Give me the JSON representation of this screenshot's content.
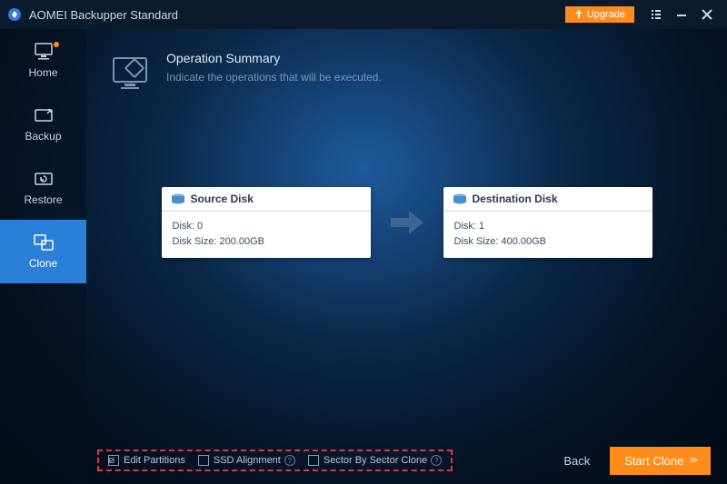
{
  "app": {
    "title": "AOMEI Backupper Standard",
    "upgrade_label": "Upgrade"
  },
  "sidebar": {
    "items": [
      {
        "label": "Home"
      },
      {
        "label": "Backup"
      },
      {
        "label": "Restore"
      },
      {
        "label": "Clone"
      }
    ]
  },
  "summary": {
    "title": "Operation Summary",
    "subtitle": "Indicate the operations that will be executed."
  },
  "source": {
    "title": "Source Disk",
    "line1": "Disk: 0",
    "line2": "Disk Size: 200.00GB"
  },
  "destination": {
    "title": "Destination Disk",
    "line1": "Disk: 1",
    "line2": "Disk Size: 400.00GB"
  },
  "options": {
    "edit_partitions": "Edit Partitions",
    "ssd_alignment": "SSD Alignment",
    "sector_by_sector": "Sector By Sector Clone"
  },
  "footer": {
    "back": "Back",
    "start": "Start Clone"
  }
}
